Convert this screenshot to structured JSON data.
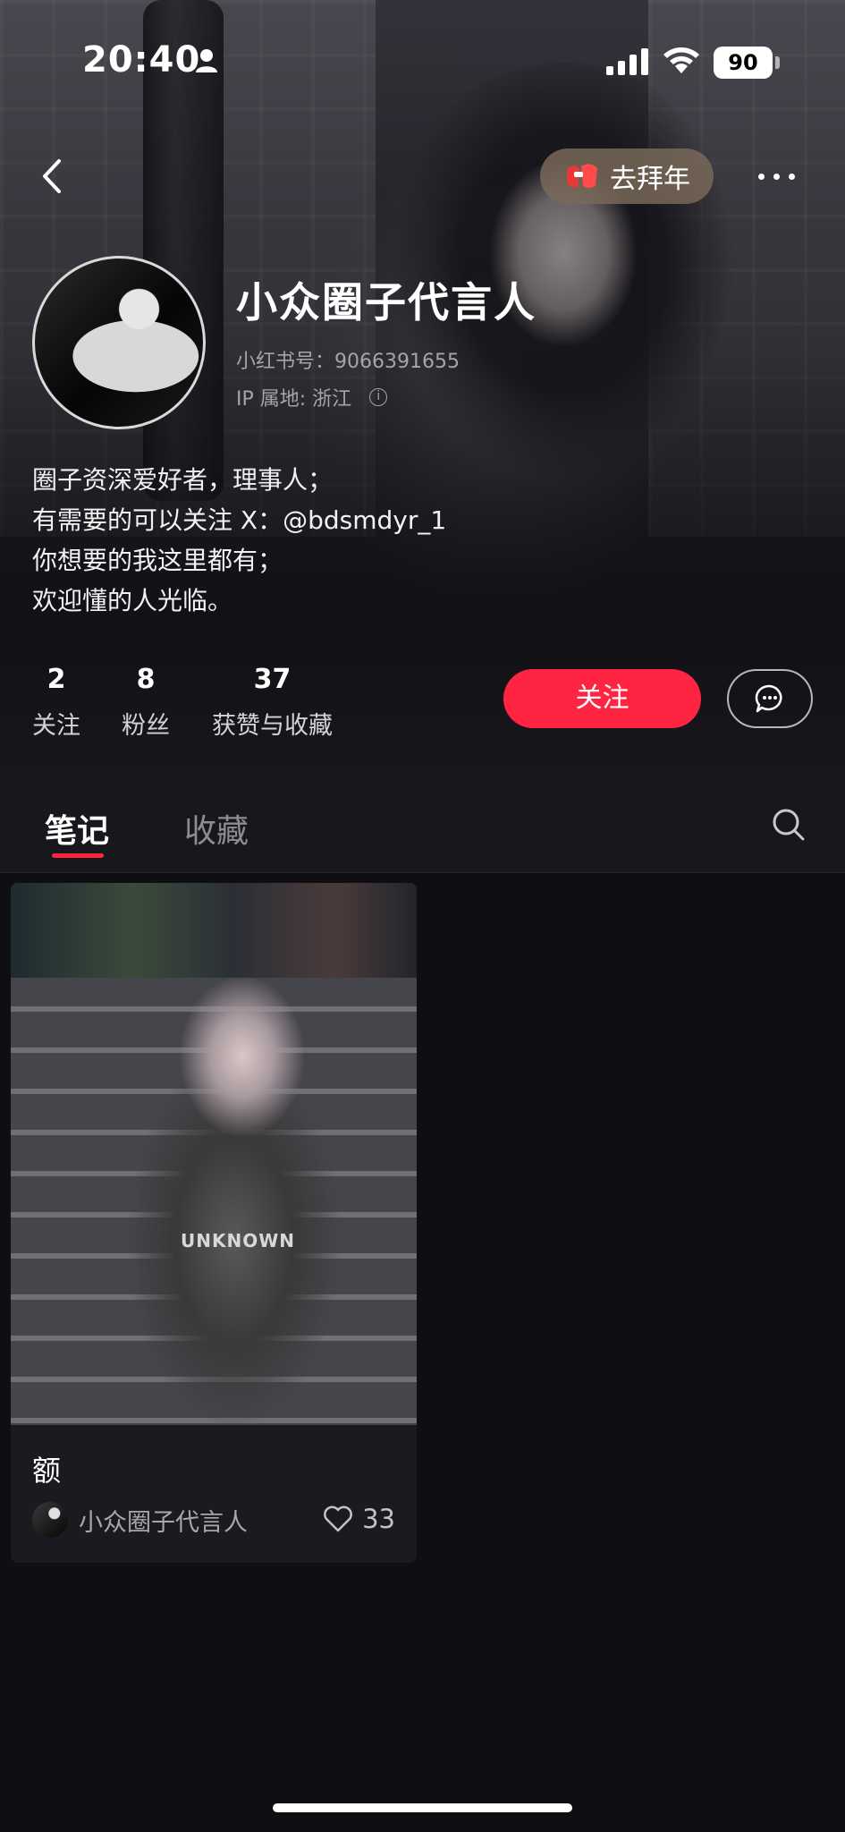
{
  "status_bar": {
    "time": "20:40",
    "battery": "90"
  },
  "header": {
    "visit_button_label": "去拜年"
  },
  "profile": {
    "nickname": "小众圈子代言人",
    "redbook_id": "小红书号：9066391655",
    "ip_location": "IP 属地: 浙江",
    "bio_lines": [
      "圈子资深爱好者，理事人；",
      "有需要的可以关注 X：@bdsmdyr_1",
      "你想要的我这里都有；",
      "欢迎懂的人光临。"
    ]
  },
  "stats": [
    {
      "value": "2",
      "label": "关注"
    },
    {
      "value": "8",
      "label": "粉丝"
    },
    {
      "value": "37",
      "label": "获赞与收藏"
    }
  ],
  "actions": {
    "follow_label": "关注"
  },
  "tabs": [
    {
      "label": "笔记",
      "active": true
    },
    {
      "label": "收藏",
      "active": false
    }
  ],
  "notes": [
    {
      "title": "额",
      "author": "小众圈子代言人",
      "likes": "33",
      "image_text": "UNKNOWN"
    }
  ],
  "colors": {
    "accent": "#ff2442",
    "background": "#0f0e13"
  }
}
